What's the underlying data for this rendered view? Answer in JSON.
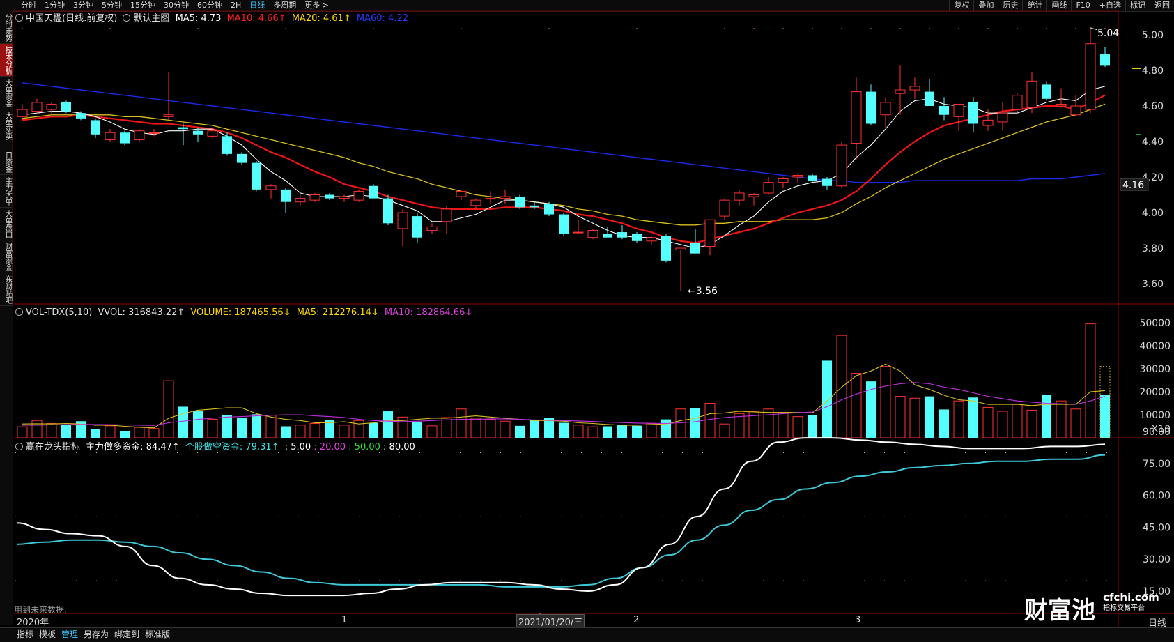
{
  "topbar": {
    "tabs": [
      "分时",
      "1分钟",
      "3分钟",
      "5分钟",
      "15分钟",
      "30分钟",
      "60分钟",
      "2H",
      "日线",
      "多周期",
      "更多 >"
    ],
    "active_tab": "日线",
    "right_tools": [
      "复权",
      "叠加",
      "历史",
      "统计",
      "画线",
      "F10",
      "+自选",
      "标记",
      "返回"
    ]
  },
  "sidebar": {
    "items": [
      "分时走势",
      "技术分析",
      "大单资金",
      "大单买卖",
      "一日资金",
      "主力大单",
      "大单盘口",
      "财富资金",
      "东财贴吧"
    ],
    "active": "技术分析"
  },
  "main_legend": {
    "title": "中国天楹(日线.前复权)",
    "template": "默认主图",
    "ma5": "MA5: 4.73",
    "ma10": "MA10: 4.66↑",
    "ma20": "MA20: 4.61↑",
    "ma60": "MA60: 4.22",
    "colors": {
      "ma5": "#ffffff",
      "ma10": "#ff2020",
      "ma20": "#ffd700",
      "ma60": "#1a1aff"
    }
  },
  "price_axis": [
    "5.00",
    "4.80",
    "4.60",
    "4.40",
    "4.20",
    "4.00",
    "3.80",
    "3.60"
  ],
  "price_marks": {
    "high": "5.04",
    "low": "3.56",
    "current": "4.16"
  },
  "vol_legend": {
    "name": "VOL-TDX(5,10)",
    "vvol": "VVOL: 316843.22↑",
    "volume": "VOLUME: 187465.56↓",
    "ma5": "MA5: 212276.14↓",
    "ma10": "MA10: 182864.66↓"
  },
  "vol_axis": [
    "50000",
    "40000",
    "30000",
    "20000",
    "10000",
    "X10"
  ],
  "ind_legend": {
    "name": "赢在龙头指标",
    "zl": "主力做多资金: 84.47↑",
    "gg": "个股做空资金: 79.31↑",
    "v1": ": 5.00",
    "v2": ": 20.00",
    "v3": ": 50.00",
    "v4": ": 80.00"
  },
  "ind_axis": [
    "90.00",
    "75.00",
    "60.00",
    "45.00",
    "30.00",
    "15.00"
  ],
  "footer_note": "用到未来数据.",
  "date_axis": {
    "start": "2020年",
    "m1": "1",
    "cursor_date": "2021/01/20/三",
    "m2": "2",
    "m3": "3",
    "period": "日线"
  },
  "bottom_buttons": [
    "指标",
    "模板",
    "管理",
    "另存为",
    "绑定到",
    "标准版"
  ],
  "active_bottom": "管理",
  "watermark": {
    "logo": "财富池",
    "site": "cfchi.com",
    "sub": "指标交易平台"
  },
  "candles": [
    {
      "o": 4.54,
      "h": 4.61,
      "l": 4.52,
      "c": 4.58
    },
    {
      "o": 4.57,
      "h": 4.64,
      "l": 4.56,
      "c": 4.62
    },
    {
      "o": 4.58,
      "h": 4.62,
      "l": 4.55,
      "c": 4.61
    },
    {
      "o": 4.62,
      "h": 4.63,
      "l": 4.56,
      "c": 4.57
    },
    {
      "o": 4.56,
      "h": 4.57,
      "l": 4.52,
      "c": 4.53
    },
    {
      "o": 4.52,
      "h": 4.53,
      "l": 4.42,
      "c": 4.44
    },
    {
      "o": 4.41,
      "h": 4.47,
      "l": 4.4,
      "c": 4.45
    },
    {
      "o": 4.45,
      "h": 4.46,
      "l": 4.38,
      "c": 4.39
    },
    {
      "o": 4.41,
      "h": 4.47,
      "l": 4.4,
      "c": 4.46
    },
    {
      "o": 4.45,
      "h": 4.47,
      "l": 4.43,
      "c": 4.45
    },
    {
      "o": 4.54,
      "h": 4.79,
      "l": 4.52,
      "c": 4.55
    },
    {
      "o": 4.48,
      "h": 4.5,
      "l": 4.38,
      "c": 4.47
    },
    {
      "o": 4.46,
      "h": 4.48,
      "l": 4.4,
      "c": 4.44
    },
    {
      "o": 4.43,
      "h": 4.48,
      "l": 4.42,
      "c": 4.46
    },
    {
      "o": 4.43,
      "h": 4.45,
      "l": 4.32,
      "c": 4.33
    },
    {
      "o": 4.33,
      "h": 4.34,
      "l": 4.27,
      "c": 4.28
    },
    {
      "o": 4.28,
      "h": 4.29,
      "l": 4.12,
      "c": 4.13
    },
    {
      "o": 4.13,
      "h": 4.16,
      "l": 4.08,
      "c": 4.15
    },
    {
      "o": 4.13,
      "h": 4.14,
      "l": 4.0,
      "c": 4.06
    },
    {
      "o": 4.06,
      "h": 4.1,
      "l": 4.04,
      "c": 4.08
    },
    {
      "o": 4.07,
      "h": 4.11,
      "l": 4.06,
      "c": 4.1
    },
    {
      "o": 4.1,
      "h": 4.11,
      "l": 4.07,
      "c": 4.08
    },
    {
      "o": 4.08,
      "h": 4.1,
      "l": 4.06,
      "c": 4.09
    },
    {
      "o": 4.07,
      "h": 4.13,
      "l": 4.06,
      "c": 4.12
    },
    {
      "o": 4.15,
      "h": 4.16,
      "l": 4.09,
      "c": 4.08
    },
    {
      "o": 4.08,
      "h": 4.1,
      "l": 3.93,
      "c": 3.94
    },
    {
      "o": 3.91,
      "h": 4.02,
      "l": 3.81,
      "c": 4.0
    },
    {
      "o": 3.98,
      "h": 4.0,
      "l": 3.83,
      "c": 3.86
    },
    {
      "o": 3.9,
      "h": 3.94,
      "l": 3.88,
      "c": 3.92
    },
    {
      "o": 3.95,
      "h": 4.04,
      "l": 3.88,
      "c": 4.02
    },
    {
      "o": 4.09,
      "h": 4.13,
      "l": 4.07,
      "c": 4.12
    },
    {
      "o": 4.04,
      "h": 4.08,
      "l": 4.02,
      "c": 4.07
    },
    {
      "o": 4.08,
      "h": 4.12,
      "l": 4.05,
      "c": 4.08
    },
    {
      "o": 4.08,
      "h": 4.13,
      "l": 4.05,
      "c": 4.09
    },
    {
      "o": 4.09,
      "h": 4.1,
      "l": 4.02,
      "c": 4.03
    },
    {
      "o": 4.04,
      "h": 4.06,
      "l": 4.02,
      "c": 4.03
    },
    {
      "o": 4.05,
      "h": 4.06,
      "l": 3.98,
      "c": 3.99
    },
    {
      "o": 3.99,
      "h": 4.0,
      "l": 3.87,
      "c": 3.88
    },
    {
      "o": 3.89,
      "h": 3.96,
      "l": 3.88,
      "c": 3.89
    },
    {
      "o": 3.86,
      "h": 3.91,
      "l": 3.85,
      "c": 3.9
    },
    {
      "o": 3.88,
      "h": 3.92,
      "l": 3.87,
      "c": 3.86
    },
    {
      "o": 3.89,
      "h": 3.93,
      "l": 3.85,
      "c": 3.86
    },
    {
      "o": 3.88,
      "h": 3.89,
      "l": 3.83,
      "c": 3.84
    },
    {
      "o": 3.84,
      "h": 3.87,
      "l": 3.82,
      "c": 3.86
    },
    {
      "o": 3.87,
      "h": 3.88,
      "l": 3.72,
      "c": 3.73
    },
    {
      "o": 3.79,
      "h": 3.8,
      "l": 3.56,
      "c": 3.8
    },
    {
      "o": 3.83,
      "h": 3.91,
      "l": 3.77,
      "c": 3.77
    },
    {
      "o": 3.81,
      "h": 3.96,
      "l": 3.76,
      "c": 3.96
    },
    {
      "o": 3.98,
      "h": 4.08,
      "l": 3.96,
      "c": 4.07
    },
    {
      "o": 4.07,
      "h": 4.13,
      "l": 4.04,
      "c": 4.11
    },
    {
      "o": 4.09,
      "h": 4.11,
      "l": 4.04,
      "c": 4.1
    },
    {
      "o": 4.11,
      "h": 4.2,
      "l": 4.1,
      "c": 4.17
    },
    {
      "o": 4.17,
      "h": 4.2,
      "l": 4.14,
      "c": 4.19
    },
    {
      "o": 4.2,
      "h": 4.22,
      "l": 4.17,
      "c": 4.21
    },
    {
      "o": 4.21,
      "h": 4.22,
      "l": 4.17,
      "c": 4.18
    },
    {
      "o": 4.19,
      "h": 4.2,
      "l": 4.13,
      "c": 4.15
    },
    {
      "o": 4.15,
      "h": 4.4,
      "l": 4.14,
      "c": 4.38
    },
    {
      "o": 4.39,
      "h": 4.76,
      "l": 4.3,
      "c": 4.68
    },
    {
      "o": 4.68,
      "h": 4.72,
      "l": 4.49,
      "c": 4.5
    },
    {
      "o": 4.55,
      "h": 4.65,
      "l": 4.48,
      "c": 4.62
    },
    {
      "o": 4.67,
      "h": 4.83,
      "l": 4.55,
      "c": 4.69
    },
    {
      "o": 4.69,
      "h": 4.76,
      "l": 4.64,
      "c": 4.71
    },
    {
      "o": 4.68,
      "h": 4.75,
      "l": 4.6,
      "c": 4.6
    },
    {
      "o": 4.6,
      "h": 4.65,
      "l": 4.52,
      "c": 4.55
    },
    {
      "o": 4.54,
      "h": 4.61,
      "l": 4.46,
      "c": 4.61
    },
    {
      "o": 4.62,
      "h": 4.65,
      "l": 4.45,
      "c": 4.5
    },
    {
      "o": 4.49,
      "h": 4.58,
      "l": 4.46,
      "c": 4.52
    },
    {
      "o": 4.51,
      "h": 4.62,
      "l": 4.46,
      "c": 4.56
    },
    {
      "o": 4.58,
      "h": 4.67,
      "l": 4.56,
      "c": 4.66
    },
    {
      "o": 4.59,
      "h": 4.79,
      "l": 4.56,
      "c": 4.74
    },
    {
      "o": 4.72,
      "h": 4.74,
      "l": 4.63,
      "c": 4.64
    },
    {
      "o": 4.6,
      "h": 4.7,
      "l": 4.59,
      "c": 4.61
    },
    {
      "o": 4.55,
      "h": 4.66,
      "l": 4.54,
      "c": 4.6
    },
    {
      "o": 4.58,
      "h": 5.04,
      "l": 4.56,
      "c": 4.95
    },
    {
      "o": 4.89,
      "h": 4.93,
      "l": 4.82,
      "c": 4.83
    }
  ],
  "ma5_line": [
    4.55,
    4.56,
    4.57,
    4.57,
    4.56,
    4.54,
    4.51,
    4.47,
    4.45,
    4.44,
    4.46,
    4.46,
    4.47,
    4.47,
    4.43,
    4.38,
    4.3,
    4.23,
    4.18,
    4.11,
    4.09,
    4.09,
    4.09,
    4.1,
    4.09,
    4.07,
    4.04,
    4.01,
    3.95,
    3.95,
    3.97,
    3.99,
    4.03,
    4.07,
    4.07,
    4.06,
    4.05,
    4.03,
    3.98,
    3.94,
    3.9,
    3.87,
    3.86,
    3.86,
    3.84,
    3.82,
    3.8,
    3.82,
    3.87,
    3.93,
    3.98,
    4.06,
    4.12,
    4.15,
    4.17,
    4.18,
    4.22,
    4.31,
    4.38,
    4.47,
    4.57,
    4.63,
    4.64,
    4.61,
    4.6,
    4.59,
    4.56,
    4.56,
    4.56,
    4.59,
    4.62,
    4.64,
    4.63,
    4.69,
    4.71
  ],
  "ma10_line": [
    4.52,
    4.53,
    4.54,
    4.54,
    4.55,
    4.54,
    4.53,
    4.52,
    4.51,
    4.5,
    4.5,
    4.49,
    4.48,
    4.47,
    4.45,
    4.42,
    4.38,
    4.34,
    4.31,
    4.27,
    4.23,
    4.2,
    4.16,
    4.14,
    4.12,
    4.09,
    4.07,
    4.05,
    4.03,
    4.02,
    4.02,
    4.02,
    4.02,
    4.03,
    4.03,
    4.03,
    4.02,
    4.01,
    3.99,
    3.98,
    3.96,
    3.94,
    3.91,
    3.89,
    3.86,
    3.84,
    3.83,
    3.85,
    3.87,
    3.89,
    3.91,
    3.94,
    3.97,
    4.0,
    4.02,
    4.04,
    4.07,
    4.12,
    4.19,
    4.27,
    4.34,
    4.4,
    4.45,
    4.49,
    4.51,
    4.53,
    4.55,
    4.57,
    4.58,
    4.59,
    4.6,
    4.6,
    4.58,
    4.62,
    4.66
  ],
  "ma20_line": [
    4.53,
    4.54,
    4.55,
    4.55,
    4.55,
    4.55,
    4.55,
    4.54,
    4.54,
    4.53,
    4.52,
    4.51,
    4.5,
    4.49,
    4.47,
    4.45,
    4.43,
    4.41,
    4.39,
    4.37,
    4.35,
    4.33,
    4.31,
    4.28,
    4.26,
    4.23,
    4.21,
    4.19,
    4.16,
    4.14,
    4.12,
    4.1,
    4.09,
    4.08,
    4.07,
    4.06,
    4.05,
    4.04,
    4.02,
    4.01,
    3.99,
    3.98,
    3.96,
    3.95,
    3.94,
    3.93,
    3.93,
    3.94,
    3.94,
    3.95,
    3.95,
    3.95,
    3.96,
    3.96,
    3.96,
    3.97,
    4.0,
    4.05,
    4.09,
    4.14,
    4.18,
    4.22,
    4.26,
    4.3,
    4.33,
    4.36,
    4.39,
    4.42,
    4.45,
    4.48,
    4.51,
    4.53,
    4.55,
    4.58,
    4.61
  ],
  "ma60_line": [
    4.73,
    4.72,
    4.71,
    4.7,
    4.69,
    4.68,
    4.67,
    4.66,
    4.65,
    4.64,
    4.63,
    4.62,
    4.61,
    4.6,
    4.59,
    4.58,
    4.57,
    4.56,
    4.55,
    4.54,
    4.53,
    4.52,
    4.51,
    4.5,
    4.49,
    4.48,
    4.47,
    4.46,
    4.45,
    4.44,
    4.43,
    4.42,
    4.41,
    4.4,
    4.39,
    4.38,
    4.37,
    4.36,
    4.35,
    4.34,
    4.33,
    4.32,
    4.31,
    4.3,
    4.29,
    4.28,
    4.27,
    4.26,
    4.25,
    4.24,
    4.23,
    4.22,
    4.21,
    4.2,
    4.19,
    4.18,
    4.18,
    4.17,
    4.17,
    4.17,
    4.17,
    4.18,
    4.18,
    4.18,
    4.18,
    4.18,
    4.18,
    4.18,
    4.18,
    4.19,
    4.19,
    4.19,
    4.2,
    4.21,
    4.22
  ],
  "volumes": [
    4800,
    7500,
    6200,
    5500,
    7200,
    3800,
    5200,
    2800,
    4500,
    4000,
    24800,
    13500,
    11500,
    8000,
    9800,
    8800,
    10200,
    9800,
    5000,
    5500,
    6200,
    7800,
    5500,
    7500,
    6500,
    11500,
    9000,
    7000,
    5200,
    8800,
    12500,
    8500,
    8000,
    7200,
    5200,
    7800,
    8500,
    6500,
    5500,
    4800,
    5000,
    5500,
    5200,
    6200,
    8000,
    12500,
    12800,
    15000,
    6000,
    10500,
    11500,
    12500,
    11000,
    9200,
    10000,
    33500,
    44500,
    28000,
    24500,
    31000,
    18000,
    17200,
    18000,
    12300,
    16000,
    17500,
    13200,
    11500,
    14500,
    12000,
    18500,
    16000,
    12500,
    49500,
    18500
  ],
  "vol_ma5": [
    6000,
    6100,
    6000,
    6200,
    6000,
    5500,
    5500,
    5000,
    4600,
    4300,
    8500,
    10500,
    12000,
    12500,
    13000,
    13000,
    10500,
    9000,
    8000,
    7500,
    6500,
    6500,
    7000,
    6000,
    6500,
    7500,
    7500,
    8000,
    8500,
    8500,
    9000,
    9500,
    9000,
    8500,
    8000,
    7500,
    7500,
    7200,
    6500,
    6200,
    5800,
    5500,
    5500,
    5800,
    6000,
    7500,
    8500,
    10500,
    10800,
    11500,
    11200,
    11000,
    11000,
    11000,
    10800,
    16000,
    22000,
    27000,
    29000,
    32000,
    29000,
    23000,
    21000,
    18500,
    16500,
    16000,
    14500,
    14500,
    14500,
    14000,
    14500,
    14500,
    14500,
    20000,
    20500
  ],
  "vol_ma10": [
    5500,
    5500,
    5600,
    5700,
    5800,
    5800,
    5700,
    5600,
    5500,
    5400,
    6500,
    7200,
    8000,
    8500,
    9000,
    9200,
    9500,
    9800,
    10000,
    10000,
    9500,
    9200,
    8800,
    8000,
    7500,
    7200,
    7000,
    7200,
    7500,
    7800,
    8000,
    8000,
    8200,
    8200,
    8000,
    7800,
    7600,
    7500,
    7300,
    7100,
    6800,
    6600,
    6400,
    6300,
    6200,
    6500,
    7000,
    8000,
    8800,
    9200,
    9600,
    10000,
    10500,
    10900,
    11200,
    13500,
    16500,
    19000,
    21000,
    22500,
    23500,
    24000,
    23500,
    22000,
    21000,
    19500,
    18000,
    17000,
    16000,
    15500,
    15000,
    14800,
    14500,
    16000,
    18000
  ],
  "ind_white": [
    47,
    44,
    42,
    41,
    36,
    27,
    21,
    18,
    16,
    14,
    13,
    13,
    13,
    14,
    16,
    18,
    19,
    19,
    19,
    18,
    16,
    15,
    18,
    26,
    37,
    50,
    63,
    76,
    85,
    87,
    87,
    86,
    85,
    84,
    83,
    82,
    82,
    82,
    83,
    83,
    84
  ],
  "ind_cyan": [
    37,
    38,
    39,
    39,
    38,
    36,
    33,
    30,
    27,
    24,
    21,
    19,
    18,
    18,
    18,
    18,
    18,
    18,
    17,
    17,
    17,
    18,
    21,
    26,
    32,
    39,
    46,
    53,
    58,
    63,
    66,
    69,
    71,
    73,
    74,
    75,
    76,
    76,
    77,
    77,
    79
  ]
}
